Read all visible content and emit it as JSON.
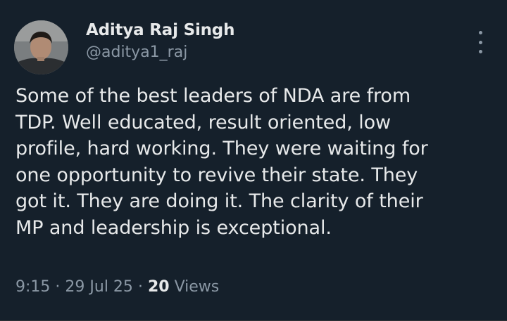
{
  "author": {
    "name": "Aditya Raj Singh",
    "handle": "@aditya1_raj"
  },
  "tweet": {
    "lines": [
      "Some of the best leaders of NDA are from",
      "TDP. Well educated, result oriented, low",
      "profile, hard working. They were waiting for",
      "one opportunity to revive their state. They",
      "got it. They are doing it. The clarity of their",
      "MP and leadership is exceptional."
    ]
  },
  "meta": {
    "time": "9:15",
    "sep1": "·",
    "date": "29 Jul 25",
    "sep2": "·",
    "views_count": "20",
    "views_label": "Views"
  },
  "icons": {
    "more": "more-vertical-icon"
  },
  "colors": {
    "background": "#15202b",
    "primary_text": "#e7e9ea",
    "secondary_text": "#8b98a5"
  }
}
